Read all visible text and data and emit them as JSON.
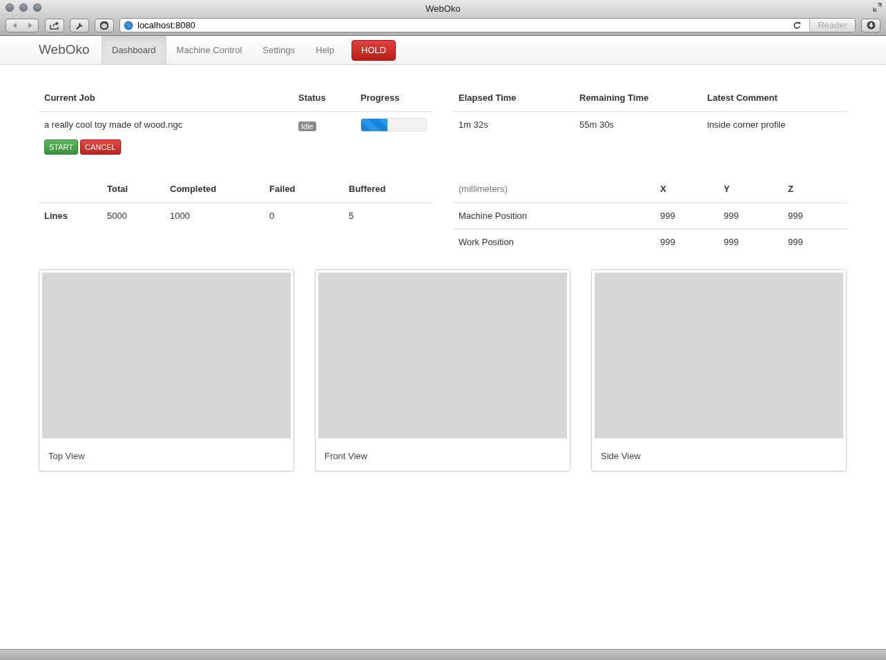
{
  "window": {
    "title": "WebOko"
  },
  "browser": {
    "url": "localhost:8080",
    "reader_button": "Reader"
  },
  "navbar": {
    "brand": "WebOko",
    "tabs": [
      {
        "label": "Dashboard",
        "selected": true
      },
      {
        "label": "Machine Control",
        "selected": false
      },
      {
        "label": "Settings",
        "selected": false
      },
      {
        "label": "Help",
        "selected": false
      }
    ],
    "hold_button": "HOLD"
  },
  "job_table": {
    "columns": [
      "Current Job",
      "Status",
      "Progress"
    ],
    "job": "a really cool toy made of wood.ngc",
    "status": "Idle",
    "progress": {
      "level": 0.4
    },
    "buttons": [
      {
        "label": "START",
        "kind": "start"
      },
      {
        "label": "CANCEL",
        "kind": "cancel"
      }
    ]
  },
  "time_table": {
    "columns": [
      "Elapsed Time",
      "Remaining Time",
      "Latest Comment"
    ],
    "row": [
      "1m 32s",
      "55m 30s",
      "inside corner profile"
    ]
  },
  "lines_table": {
    "columns": [
      "Total",
      "Completed",
      "Failed",
      "Buffered"
    ],
    "rows": [
      {
        "label": "Lines",
        "cells": [
          "5000",
          "1000",
          "0",
          "5"
        ]
      }
    ]
  },
  "position_table": {
    "columns": [
      "(millimeters)",
      "X",
      "Y",
      "Z"
    ],
    "rows": [
      [
        "Machine Position",
        "999",
        "999",
        "999"
      ],
      [
        "Work Position",
        "999",
        "999",
        "999"
      ]
    ]
  },
  "views": [
    {
      "caption": "Top View"
    },
    {
      "caption": "Front View"
    },
    {
      "caption": "Side View"
    }
  ]
}
